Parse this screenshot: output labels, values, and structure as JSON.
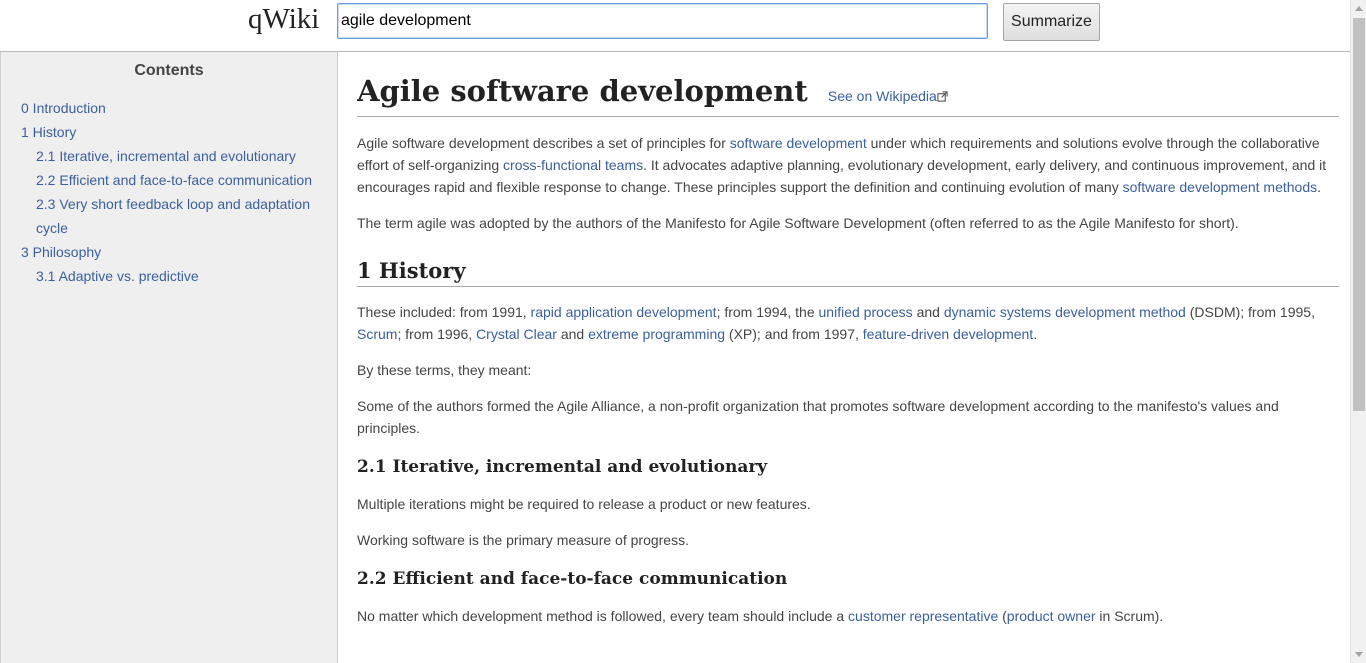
{
  "header": {
    "logo": "qWiki",
    "search_value": "agile development",
    "summarize_label": "Summarize"
  },
  "toc": {
    "title": "Contents",
    "items": [
      {
        "label": "0 Introduction",
        "level": 1
      },
      {
        "label": "1 History",
        "level": 1
      },
      {
        "label": "2.1 Iterative, incremental and evolutionary",
        "level": 2
      },
      {
        "label": "2.2 Efficient and face-to-face communication",
        "level": 2
      },
      {
        "label": "2.3 Very short feedback loop and adaptation cycle",
        "level": 2
      },
      {
        "label": "3 Philosophy",
        "level": 1
      },
      {
        "label": "3.1 Adaptive vs. predictive",
        "level": 2
      }
    ]
  },
  "article": {
    "title": "Agile software development",
    "wiki_link": "See on Wikipedia",
    "intro_p1": [
      {
        "t": "Agile software development describes a set of principles for "
      },
      {
        "t": "software development",
        "link": true
      },
      {
        "t": " under which requirements and solutions evolve through the collaborative effort of self-organizing "
      },
      {
        "t": "cross-functional teams",
        "link": true
      },
      {
        "t": ". It advocates adaptive planning, evolutionary development, early delivery, and continuous improvement, and it encourages rapid and flexible response to change. These principles support the definition and continuing evolution of many "
      },
      {
        "t": "software development methods",
        "link": true
      },
      {
        "t": "."
      }
    ],
    "intro_p2": "The term agile was adopted by the authors of the Manifesto for Agile Software Development (often referred to as the Agile Manifesto for short).",
    "history_heading": "1 History",
    "history_p1": [
      {
        "t": "These included: from 1991, "
      },
      {
        "t": "rapid application development",
        "link": true
      },
      {
        "t": "; from 1994, the "
      },
      {
        "t": "unified process",
        "link": true
      },
      {
        "t": " and "
      },
      {
        "t": "dynamic systems development method",
        "link": true
      },
      {
        "t": " (DSDM); from 1995, "
      },
      {
        "t": "Scrum",
        "link": true
      },
      {
        "t": "; from 1996, "
      },
      {
        "t": "Crystal Clear",
        "link": true
      },
      {
        "t": " and "
      },
      {
        "t": "extreme programming",
        "link": true
      },
      {
        "t": " (XP); and from 1997, "
      },
      {
        "t": "feature-driven development",
        "link": true
      },
      {
        "t": "."
      }
    ],
    "history_p2": "By these terms, they meant:",
    "history_p3": "Some of the authors formed the Agile Alliance, a non-profit organization that promotes software development according to the manifesto's values and principles.",
    "s21_heading": "2.1 Iterative, incremental and evolutionary",
    "s21_p1": "Multiple iterations might be required to release a product or new features.",
    "s21_p2": "Working software is the primary measure of progress.",
    "s22_heading": "2.2 Efficient and face-to-face communication",
    "s22_p1": [
      {
        "t": "No matter which development method is followed, every team should include a "
      },
      {
        "t": "customer representative",
        "link": true
      },
      {
        "t": " ("
      },
      {
        "t": "product owner",
        "link": true
      },
      {
        "t": " in Scrum)."
      }
    ]
  },
  "colors": {
    "link": "#3b5fa0",
    "sidebar_bg": "#efefef",
    "search_border": "#6b9bd8"
  }
}
